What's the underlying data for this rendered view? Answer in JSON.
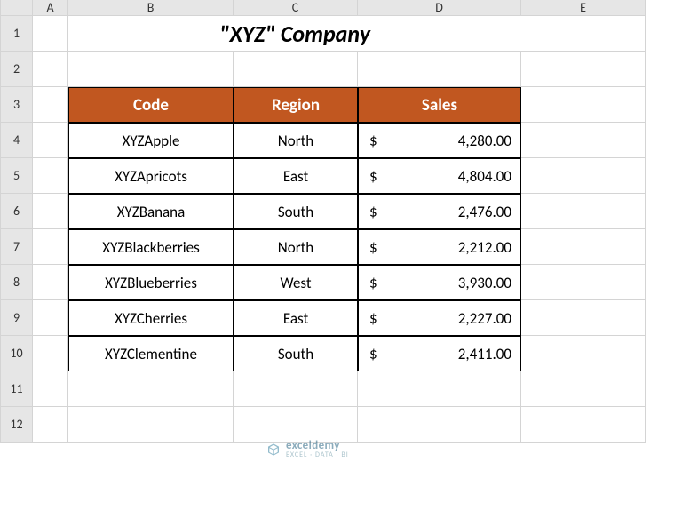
{
  "columns": [
    "A",
    "B",
    "C",
    "D",
    "E"
  ],
  "rows": [
    "1",
    "2",
    "3",
    "4",
    "5",
    "6",
    "7",
    "8",
    "9",
    "10",
    "11",
    "12"
  ],
  "title": "\"XYZ\" Company",
  "table": {
    "headers": {
      "code": "Code",
      "region": "Region",
      "sales": "Sales"
    },
    "currency": "$",
    "rows": [
      {
        "code": "XYZApple",
        "region": "North",
        "sales": "4,280.00"
      },
      {
        "code": "XYZApricots",
        "region": "East",
        "sales": "4,804.00"
      },
      {
        "code": "XYZBanana",
        "region": "South",
        "sales": "2,476.00"
      },
      {
        "code": "XYZBlackberries",
        "region": "North",
        "sales": "2,212.00"
      },
      {
        "code": "XYZBlueberries",
        "region": "West",
        "sales": "3,930.00"
      },
      {
        "code": "XYZCherries",
        "region": "East",
        "sales": "2,227.00"
      },
      {
        "code": "XYZClementine",
        "region": "South",
        "sales": "2,411.00"
      }
    ]
  },
  "watermark": {
    "brand": "exceldemy",
    "sub": "EXCEL · DATA · BI"
  }
}
